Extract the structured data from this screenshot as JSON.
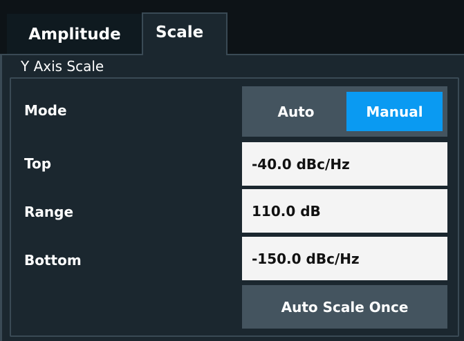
{
  "tabs": {
    "amplitude_label": "Amplitude",
    "scale_label": "Scale",
    "active": "Scale"
  },
  "group": {
    "title": "Y Axis Scale"
  },
  "mode": {
    "label": "Mode",
    "options": [
      "Auto",
      "Manual"
    ],
    "auto_label": "Auto",
    "manual_label": "Manual",
    "selected": "Manual"
  },
  "top": {
    "label": "Top",
    "value": "-40.0 dBc/Hz"
  },
  "range": {
    "label": "Range",
    "value": "110.0 dB"
  },
  "bottom": {
    "label": "Bottom",
    "value": "-150.0 dBc/Hz"
  },
  "actions": {
    "auto_scale_once_label": "Auto Scale Once"
  },
  "colors": {
    "background": "#1b272f",
    "tabbar": "#0d1317",
    "border": "#3a4a55",
    "button": "#44545f",
    "accent": "#0a9af2",
    "field": "#f4f4f4"
  }
}
